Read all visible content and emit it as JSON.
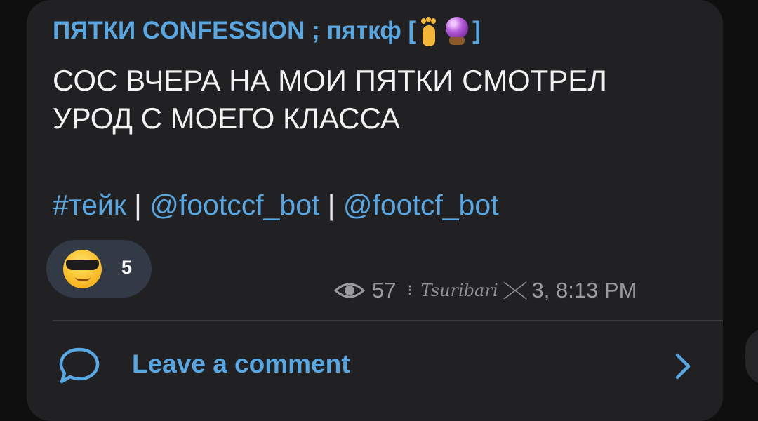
{
  "post": {
    "channel_name": "ПЯТКИ CONFESSION ; пяткф [",
    "channel_suffix": "]",
    "channel_emojis": [
      "foot-emoji",
      "crystal-ball-emoji"
    ],
    "message_line1": "СОС ВЧЕРА НА МОИ ПЯТКИ СМОТРЕЛ",
    "message_line2": "УРОД С МОЕГО КЛАССА",
    "hashtag": "#тейк",
    "separator": " | ",
    "mention1": "@footccf_bot",
    "mention2": "@footcf_bot"
  },
  "reaction": {
    "emoji": "smiling-face-with-sunglasses",
    "count": "5"
  },
  "meta": {
    "views": "57",
    "watermark": "Tsuribari",
    "time": "3, 8:13 PM"
  },
  "comments": {
    "label": "Leave a comment"
  },
  "colors": {
    "accent": "#5aa6e0",
    "bubble": "#212124",
    "background": "#0f0f10",
    "reaction_pill": "#323a46",
    "text": "#f2f2f2",
    "meta": "#9a9a9f"
  }
}
